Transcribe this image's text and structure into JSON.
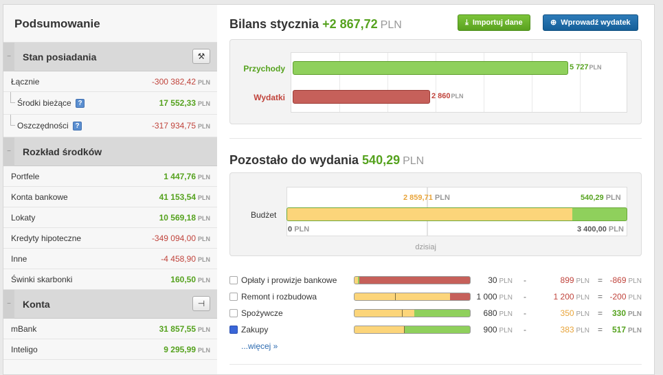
{
  "sidebar": {
    "title": "Podsumowanie",
    "sections": {
      "assets": {
        "label": "Stan posiadania"
      },
      "distribution": {
        "label": "Rozkład środków"
      },
      "accounts": {
        "label": "Konta"
      }
    },
    "assets_rows": [
      {
        "label": "Łącznie",
        "value": "-300 382,42"
      },
      {
        "label": "Środki bieżące",
        "value": "17 552,33"
      },
      {
        "label": "Oszczędności",
        "value": "-317 934,75"
      }
    ],
    "distribution_rows": [
      {
        "label": "Portfele",
        "value": "1 447,76"
      },
      {
        "label": "Konta bankowe",
        "value": "41 153,54"
      },
      {
        "label": "Lokaty",
        "value": "10 569,18"
      },
      {
        "label": "Kredyty hipoteczne",
        "value": "-349 094,00"
      },
      {
        "label": "Inne",
        "value": "-4 458,90"
      },
      {
        "label": "Świnki skarbonki",
        "value": "160,50"
      }
    ],
    "accounts_rows": [
      {
        "label": "mBank",
        "value": "31 857,55"
      },
      {
        "label": "Inteligo",
        "value": "9 295,99"
      }
    ],
    "currency": "PLN",
    "help_glyph": "?"
  },
  "balance": {
    "title": "Bilans stycznia",
    "value": "+2 867,72",
    "currency": "PLN",
    "import_label": "Importuj dane",
    "add_label": "Wprowadź wydatek"
  },
  "chart_data": {
    "type": "bar",
    "categories": [
      "Przychody",
      "Wydatki"
    ],
    "values": [
      5727,
      2860
    ],
    "value_labels": [
      "5 727",
      "2 860"
    ],
    "unit": "PLN",
    "colors": [
      "#8fd05c",
      "#c6605a"
    ]
  },
  "remaining": {
    "title": "Pozostało do wydania",
    "value": "540,29",
    "currency": "PLN",
    "budget_label": "Budżet",
    "spent_label": "2 859,71",
    "left_label": "540,29",
    "min_label": "0",
    "max_label": "3 400,00",
    "spent_fraction": 0.841,
    "today_label": "dzisiaj",
    "today_fraction": 0.41
  },
  "categories": [
    {
      "name": "Opłaty i prowizje bankowe",
      "budget": "30",
      "spent": "899",
      "diff": "-869",
      "checked": false
    },
    {
      "name": "Remont i rozbudowa",
      "budget": "1 000",
      "spent": "1 200",
      "diff": "-200",
      "checked": false
    },
    {
      "name": "Spożywcze",
      "budget": "680",
      "spent": "350",
      "diff": "330",
      "checked": false
    },
    {
      "name": "Zakupy",
      "budget": "900",
      "spent": "383",
      "diff": "517",
      "checked": true
    }
  ],
  "more_label": "...więcej »",
  "ops": {
    "minus": "-",
    "equals": "="
  }
}
